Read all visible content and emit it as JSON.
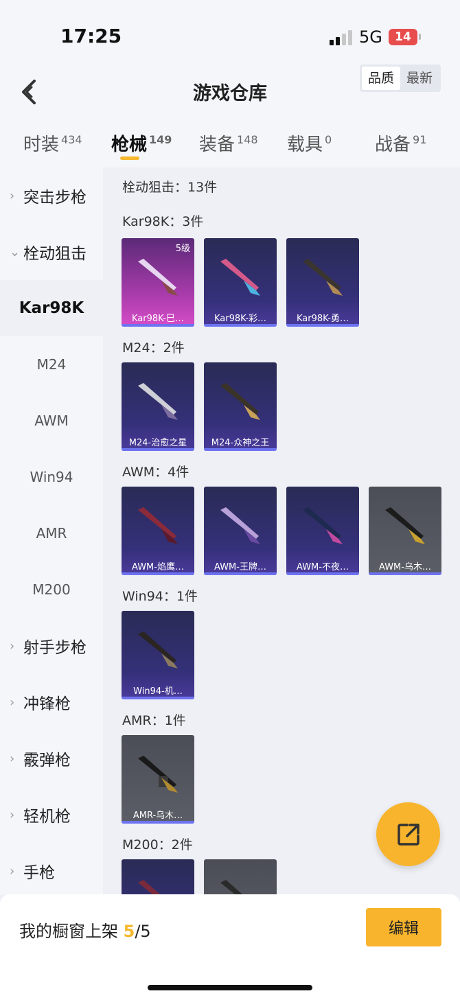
{
  "status": {
    "time": "17:25",
    "network": "5G",
    "battery": "14"
  },
  "header": {
    "title": "游戏仓库",
    "sort_quality": "品质",
    "sort_newest": "最新"
  },
  "tabs": [
    {
      "label": "时装",
      "count": "434"
    },
    {
      "label": "枪械",
      "count": "149"
    },
    {
      "label": "装备",
      "count": "148"
    },
    {
      "label": "载具",
      "count": "0"
    },
    {
      "label": "战备",
      "count": "91"
    }
  ],
  "sidebar": {
    "assault": "突击步枪",
    "bolt": "栓动狙击",
    "kar98k": "Kar98K",
    "m24": "M24",
    "awm": "AWM",
    "win94": "Win94",
    "amr": "AMR",
    "m200": "M200",
    "marksman": "射手步枪",
    "smg": "冲锋枪",
    "shotgun": "霰弹枪",
    "lmg": "轻机枪",
    "pistol": "手枪"
  },
  "content": {
    "summary": "栓动狙击：13件",
    "groups": {
      "kar98k": {
        "label": "Kar98K：3件",
        "items": [
          "Kar98K-巳…",
          "Kar98K-彩…",
          "Kar98K-勇…"
        ],
        "level": "5级"
      },
      "m24": {
        "label": "M24：2件",
        "items": [
          "M24-治愈之星",
          "M24-众神之王"
        ]
      },
      "awm": {
        "label": "AWM：4件",
        "items": [
          "AWM-焰鹰…",
          "AWM-王牌…",
          "AWM-不夜…",
          "AWM-乌木…"
        ]
      },
      "win94": {
        "label": "Win94：1件",
        "items": [
          "Win94-机…"
        ]
      },
      "amr": {
        "label": "AMR：1件",
        "items": [
          "AMR-乌木…"
        ]
      },
      "m200": {
        "label": "M200：2件"
      }
    }
  },
  "bottom": {
    "showcase_label": "我的橱窗上架",
    "showcase_current": "5",
    "showcase_total": "/5",
    "edit": "编辑"
  },
  "icons": {
    "back": "chevron-left-icon",
    "share": "share-external-icon",
    "gun": "sniper-rifle-icon"
  },
  "colors": {
    "accent": "#f7b42c",
    "card_blue": "#35307a",
    "card_pink": "#d64dc8",
    "card_gray": "#5b5e66",
    "rarity_bar": "#6d73f0"
  }
}
